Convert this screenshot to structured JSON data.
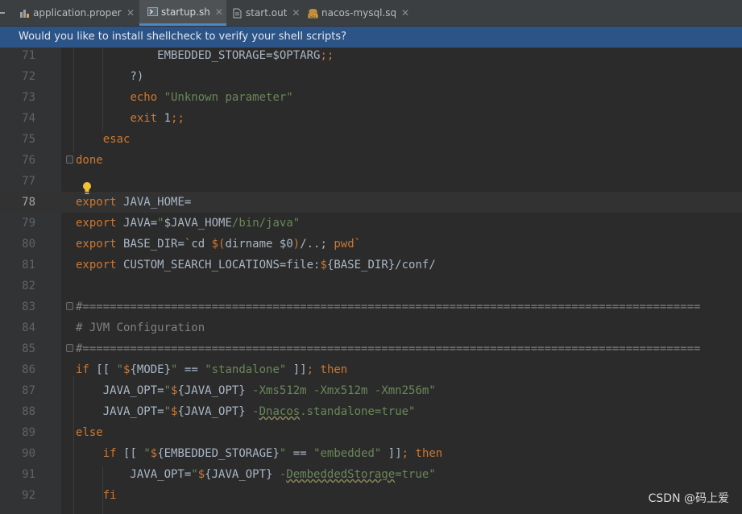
{
  "tabs": [
    {
      "label": "application.properties",
      "icon": "properties-file-icon",
      "active": false
    },
    {
      "label": "startup.sh",
      "icon": "shell-script-icon",
      "active": true
    },
    {
      "label": "start.out",
      "icon": "text-file-icon",
      "active": false
    },
    {
      "label": "nacos-mysql.sql",
      "icon": "sql-file-icon",
      "active": false
    }
  ],
  "close_glyph": "✕",
  "banner": {
    "text": "Would you like to install shellcheck to verify your shell scripts?"
  },
  "editor": {
    "current_line": "78",
    "lines": [
      {
        "n": "71",
        "tokens": [
          [
            "plain",
            "            EMBEDDED_STORAGE=$OPTARG"
          ],
          [
            "kw",
            ";;"
          ]
        ]
      },
      {
        "n": "72",
        "tokens": [
          [
            "plain",
            "        ?)"
          ]
        ]
      },
      {
        "n": "73",
        "tokens": [
          [
            "plain",
            "        "
          ],
          [
            "kw",
            "echo "
          ],
          [
            "str",
            "\"Unknown parameter\""
          ]
        ]
      },
      {
        "n": "74",
        "tokens": [
          [
            "plain",
            "        "
          ],
          [
            "kw",
            "exit "
          ],
          [
            "plain",
            "1"
          ],
          [
            "kw",
            ";;"
          ]
        ]
      },
      {
        "n": "75",
        "tokens": [
          [
            "plain",
            "    "
          ],
          [
            "kw",
            "esac"
          ]
        ]
      },
      {
        "n": "76",
        "tokens": [
          [
            "kw",
            "done"
          ]
        ]
      },
      {
        "n": "77",
        "tokens": []
      },
      {
        "n": "78",
        "tokens": [
          [
            "kw",
            "export "
          ],
          [
            "plain",
            "JAVA_HOME="
          ]
        ]
      },
      {
        "n": "79",
        "tokens": [
          [
            "kw",
            "export "
          ],
          [
            "plain",
            "JAVA="
          ],
          [
            "str",
            "\""
          ],
          [
            "plain",
            "$JAVA_HOME"
          ],
          [
            "str",
            "/bin/java\""
          ]
        ]
      },
      {
        "n": "80",
        "tokens": [
          [
            "kw",
            "export "
          ],
          [
            "plain",
            "BASE_DIR="
          ],
          [
            "kw",
            "`"
          ],
          [
            "plain",
            "cd "
          ],
          [
            "kw",
            "$("
          ],
          [
            "plain",
            "dirname $0"
          ],
          [
            "kw",
            ")"
          ],
          [
            "plain",
            "/..; "
          ],
          [
            "kw",
            "pwd`"
          ]
        ]
      },
      {
        "n": "81",
        "tokens": [
          [
            "kw",
            "export "
          ],
          [
            "plain",
            "CUSTOM_SEARCH_LOCATIONS=file:"
          ],
          [
            "kw",
            "$"
          ],
          [
            "plain",
            "{BASE_DIR}/conf/"
          ]
        ]
      },
      {
        "n": "82",
        "tokens": []
      },
      {
        "n": "83",
        "tokens": [
          [
            "cmt",
            "#==========================================================================================="
          ]
        ]
      },
      {
        "n": "84",
        "tokens": [
          [
            "cmt",
            "# JVM Configuration"
          ]
        ]
      },
      {
        "n": "85",
        "tokens": [
          [
            "cmt",
            "#==========================================================================================="
          ]
        ]
      },
      {
        "n": "86",
        "tokens": [
          [
            "kw",
            "if "
          ],
          [
            "plain",
            "[[ "
          ],
          [
            "str",
            "\""
          ],
          [
            "kw",
            "$"
          ],
          [
            "plain",
            "{MODE}"
          ],
          [
            "str",
            "\""
          ],
          [
            "plain",
            " == "
          ],
          [
            "str",
            "\"standalone\""
          ],
          [
            "plain",
            " ]]"
          ],
          [
            "kw",
            "; then"
          ]
        ]
      },
      {
        "n": "87",
        "tokens": [
          [
            "plain",
            "    JAVA_OPT="
          ],
          [
            "str",
            "\""
          ],
          [
            "kw",
            "$"
          ],
          [
            "plain",
            "{JAVA_OPT} "
          ],
          [
            "str",
            "-Xms512m -Xmx512m -Xmn256m\""
          ]
        ]
      },
      {
        "n": "88",
        "tokens": [
          [
            "plain",
            "    JAVA_OPT="
          ],
          [
            "str",
            "\""
          ],
          [
            "kw",
            "$"
          ],
          [
            "plain",
            "{JAVA_OPT} "
          ],
          [
            "str",
            "-"
          ],
          [
            "strw",
            "Dnacos"
          ],
          [
            "str",
            ".standalone=true\""
          ]
        ]
      },
      {
        "n": "89",
        "tokens": [
          [
            "kw",
            "else"
          ]
        ]
      },
      {
        "n": "90",
        "tokens": [
          [
            "plain",
            "    "
          ],
          [
            "kw",
            "if "
          ],
          [
            "plain",
            "[[ "
          ],
          [
            "str",
            "\""
          ],
          [
            "kw",
            "$"
          ],
          [
            "plain",
            "{EMBEDDED_STORAGE}"
          ],
          [
            "str",
            "\""
          ],
          [
            "plain",
            " == "
          ],
          [
            "str",
            "\"embedded\""
          ],
          [
            "plain",
            " ]]"
          ],
          [
            "kw",
            "; then"
          ]
        ]
      },
      {
        "n": "91",
        "tokens": [
          [
            "plain",
            "        JAVA_OPT="
          ],
          [
            "str",
            "\""
          ],
          [
            "kw",
            "$"
          ],
          [
            "plain",
            "{JAVA_OPT} "
          ],
          [
            "str",
            "-"
          ],
          [
            "strw",
            "DembeddedStorage"
          ],
          [
            "str",
            "=true\""
          ]
        ]
      },
      {
        "n": "92",
        "tokens": [
          [
            "plain",
            "    "
          ],
          [
            "kw",
            "fi"
          ]
        ]
      }
    ]
  },
  "watermark": "CSDN @码上爱",
  "colors": {
    "keyword": "#cc7832",
    "string": "#6a8759",
    "comment": "#808080",
    "text": "#a9b7c6",
    "banner": "#2d5487",
    "accent": "#4a88c7"
  }
}
